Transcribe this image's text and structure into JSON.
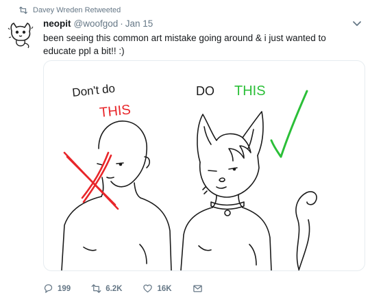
{
  "retweet_context": {
    "text": "Davey Wreden Retweeted",
    "icon": "retweet-icon"
  },
  "tweet": {
    "display_name": "neopit",
    "handle": "@woofgod",
    "separator": "·",
    "timestamp": "Jan 15",
    "text": "been seeing this common art mistake going around & i just wanted to educate ppl a bit!! :)",
    "avatar_icon": "cat-doodle-avatar",
    "caret_icon": "chevron-down-icon"
  },
  "media": {
    "left_caption_1": "Don't do",
    "left_caption_2": "THIS",
    "right_caption_1": "DO",
    "right_caption_2": "THIS",
    "colors": {
      "red": "#e8262a",
      "green": "#2bbf38",
      "ink": "#1a1a1a"
    }
  },
  "actions": {
    "reply_count": "199",
    "retweet_count": "6.2K",
    "like_count": "16K",
    "reply_icon": "reply-icon",
    "retweet_icon": "retweet-icon",
    "like_icon": "heart-icon",
    "dm_icon": "envelope-icon"
  }
}
